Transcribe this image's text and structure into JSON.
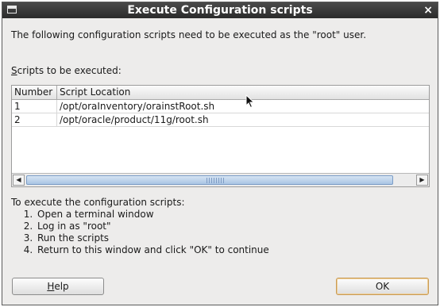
{
  "window": {
    "title": "Execute Configuration scripts",
    "close_glyph": "×"
  },
  "intro": "The following configuration scripts need to be executed as the \"root\" user.",
  "scripts_label": {
    "mnemonic": "S",
    "rest": "cripts to be executed:"
  },
  "table": {
    "headers": [
      "Number",
      "Script Location"
    ],
    "rows": [
      {
        "number": "1",
        "location": "/opt/oraInventory/orainstRoot.sh"
      },
      {
        "number": "2",
        "location": "/opt/oracle/product/11g/root.sh"
      }
    ]
  },
  "scrollbar": {
    "left_arrow": "◀",
    "right_arrow": "▶"
  },
  "instructions": {
    "heading": "To execute the configuration scripts:",
    "steps": [
      "Open a terminal window",
      "Log in as \"root\"",
      "Run the scripts",
      "Return to this window and click \"OK\" to continue"
    ]
  },
  "buttons": {
    "help_mnemonic": "H",
    "help_rest": "elp",
    "ok": "OK"
  },
  "colors": {
    "titlebar": "#2b2b2b",
    "dialog_bg": "#edeceb",
    "scroll_thumb": "#aac5e4",
    "ok_focus_border": "#c89a55"
  },
  "icons": [
    "window-menu-icon",
    "close-icon",
    "scroll-left-icon",
    "scroll-right-icon",
    "mouse-pointer-icon"
  ]
}
